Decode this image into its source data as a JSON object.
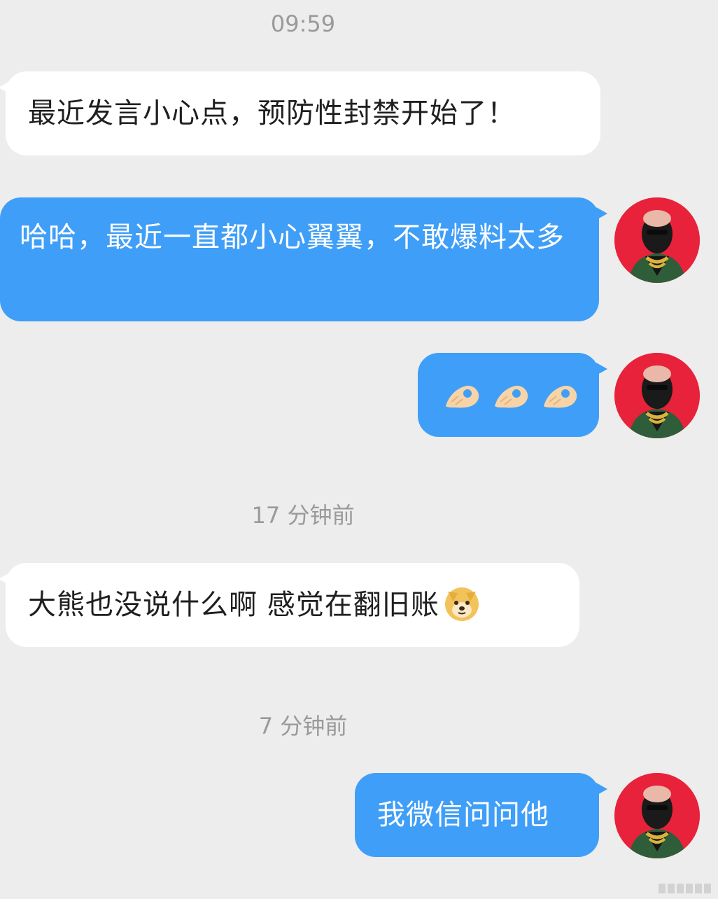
{
  "chat": {
    "timestamps": [
      "09:59",
      "17 分钟前",
      "7 分钟前"
    ],
    "messages": [
      {
        "sender": "other",
        "text": "最近发言小心点，预防性封禁开始了！"
      },
      {
        "sender": "me",
        "text": "哈哈，最近一直都小心翼翼，不敢爆料太多"
      },
      {
        "sender": "me",
        "emoji": [
          "ok-hand-emoji",
          "ok-hand-emoji",
          "ok-hand-emoji"
        ]
      },
      {
        "sender": "other",
        "text": "大熊也没说什么啊  感觉在翻旧账",
        "emoji": "doge-emoji"
      },
      {
        "sender": "me",
        "text": "我微信问问他"
      }
    ]
  },
  "colors": {
    "background": "#ededed",
    "sent_bubble": "#3f9ef7",
    "received_bubble": "#ffffff",
    "avatar_bg": "#e8223a",
    "timestamp_text": "#9a9a9a"
  }
}
